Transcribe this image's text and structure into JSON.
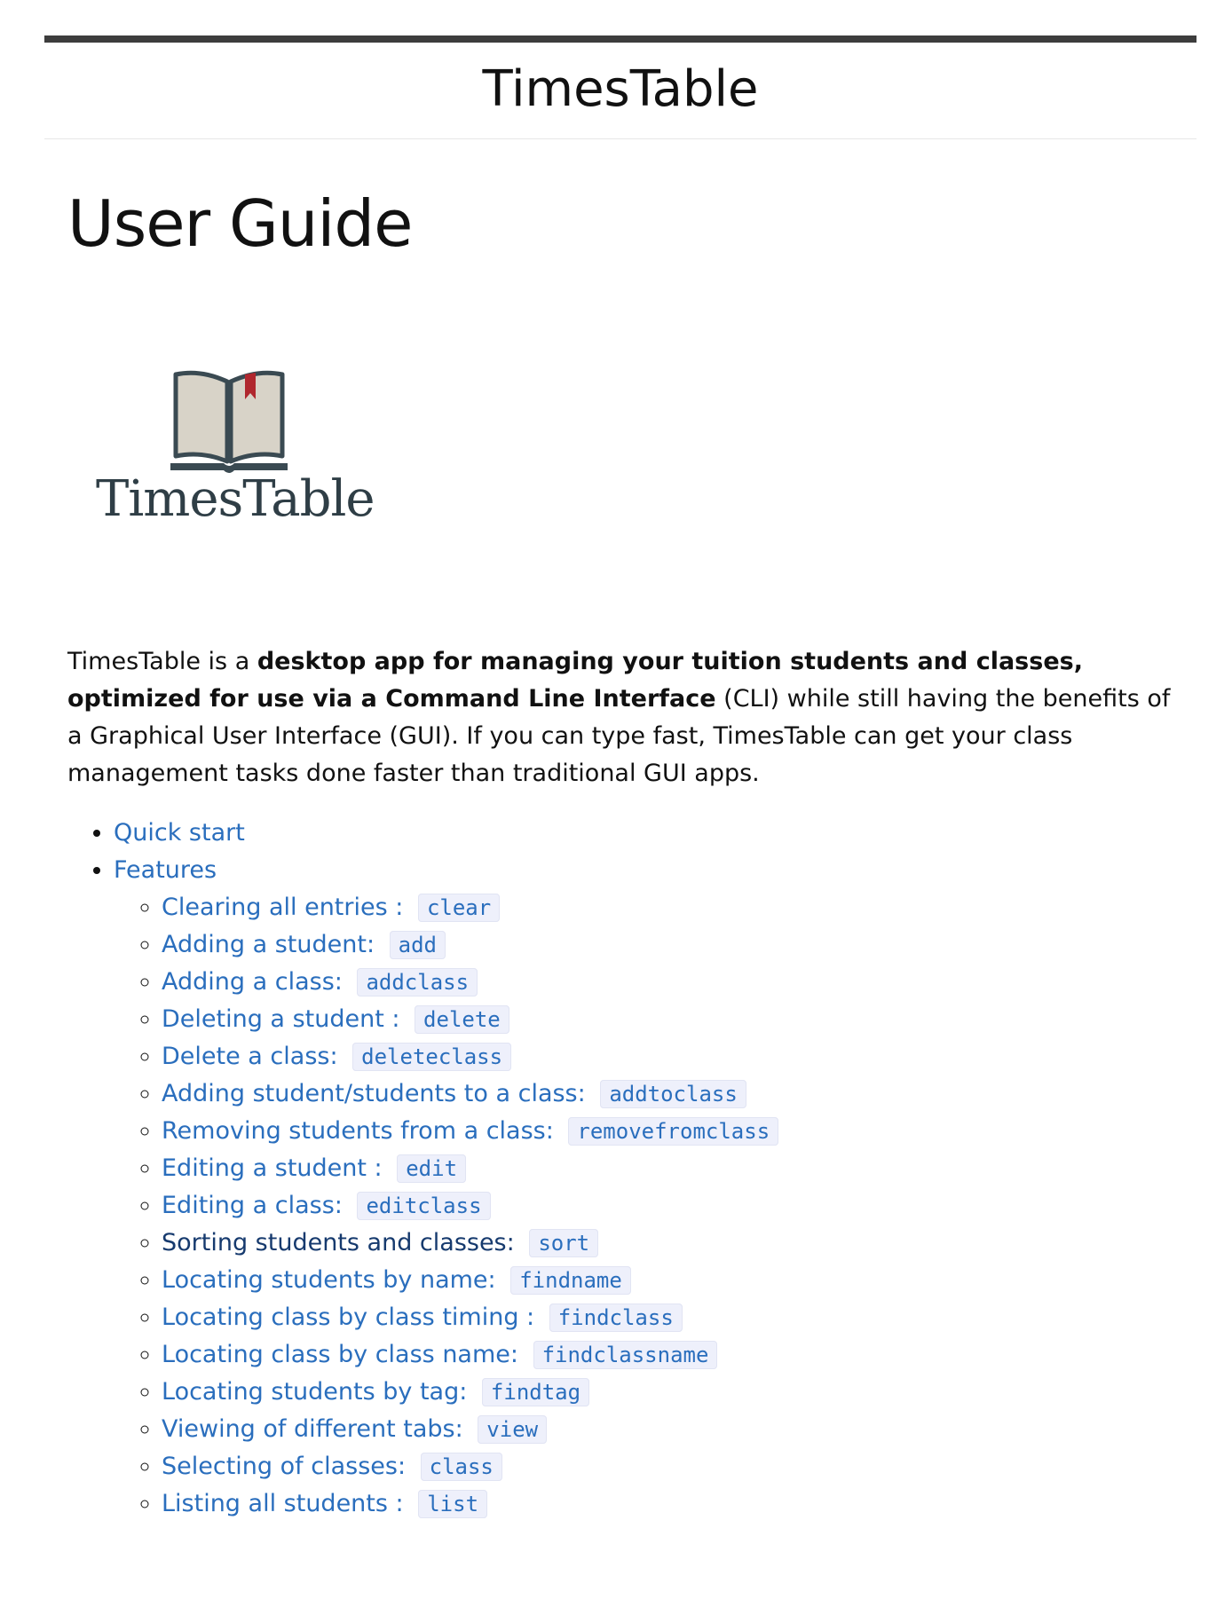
{
  "header": {
    "site_title": "TimesTable"
  },
  "page": {
    "title": "User Guide"
  },
  "logo": {
    "text": "TimesTable"
  },
  "intro": {
    "part1": "TimesTable is a ",
    "bold1": "desktop app for managing your tuition students and classes, optimized for use via a Command Line Interface",
    "part2": " (CLI) while still having the benefits of a Graphical User Interface (GUI). If you can type fast, TimesTable can get your class management tasks done faster than traditional GUI apps."
  },
  "toc": {
    "quick_start": "Quick start",
    "features": "Features",
    "items": [
      {
        "label": "Clearing all entries : ",
        "code": "clear"
      },
      {
        "label": "Adding a student: ",
        "code": "add"
      },
      {
        "label": "Adding a class: ",
        "code": "addclass"
      },
      {
        "label": "Deleting a student : ",
        "code": "delete"
      },
      {
        "label": "Delete a class: ",
        "code": "deleteclass"
      },
      {
        "label": "Adding student/students to a class: ",
        "code": "addtoclass"
      },
      {
        "label": "Removing students from a class: ",
        "code": "removefromclass"
      },
      {
        "label": "Editing a student : ",
        "code": "edit"
      },
      {
        "label": "Editing a class: ",
        "code": "editclass"
      },
      {
        "label": "Sorting students and classes: ",
        "code": "sort"
      },
      {
        "label": "Locating students by name: ",
        "code": "findname"
      },
      {
        "label": "Locating class by class timing : ",
        "code": "findclass"
      },
      {
        "label": "Locating class by class name: ",
        "code": "findclassname"
      },
      {
        "label": "Locating students by tag: ",
        "code": "findtag"
      },
      {
        "label": "Viewing of different tabs: ",
        "code": "view"
      },
      {
        "label": "Selecting of classes: ",
        "code": "class"
      },
      {
        "label": "Listing all students : ",
        "code": "list"
      }
    ]
  },
  "colors": {
    "link": "#2a6ebd",
    "visited_link": "#163a6e",
    "code_bg": "#eef0fb",
    "top_bar": "#3d3d3d"
  }
}
